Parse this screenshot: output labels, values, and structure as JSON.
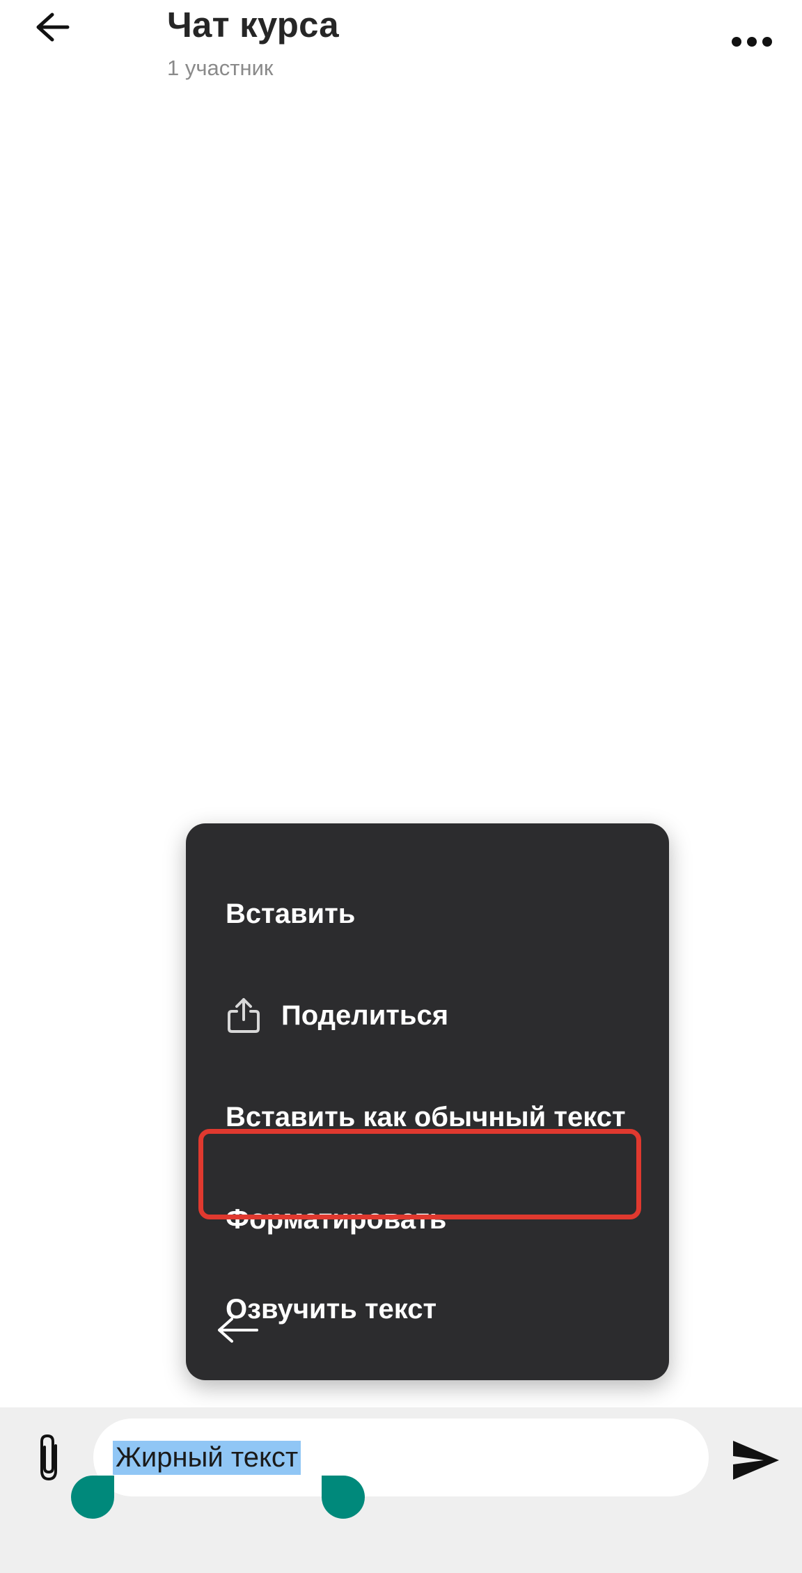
{
  "header": {
    "title": "Чат курса",
    "subtitle": "1 участник",
    "back_icon": "arrow-left-icon",
    "more_icon": "more-horizontal-icon"
  },
  "context_menu": {
    "items": [
      {
        "label": "Вставить"
      },
      {
        "label": "Поделиться",
        "icon": "share-icon"
      },
      {
        "label": "Вставить как обычный текст"
      },
      {
        "label": "Форматировать",
        "highlighted": true
      },
      {
        "label": "Озвучить текст"
      }
    ],
    "back_icon": "arrow-left-icon",
    "highlight_color": "#e0392f",
    "background_color": "#2c2c2e"
  },
  "composer": {
    "value": "Жирный текст",
    "attach_icon": "paperclip-icon",
    "send_icon": "send-icon",
    "selection_color": "#90c6f5",
    "handle_color": "#00897b"
  }
}
